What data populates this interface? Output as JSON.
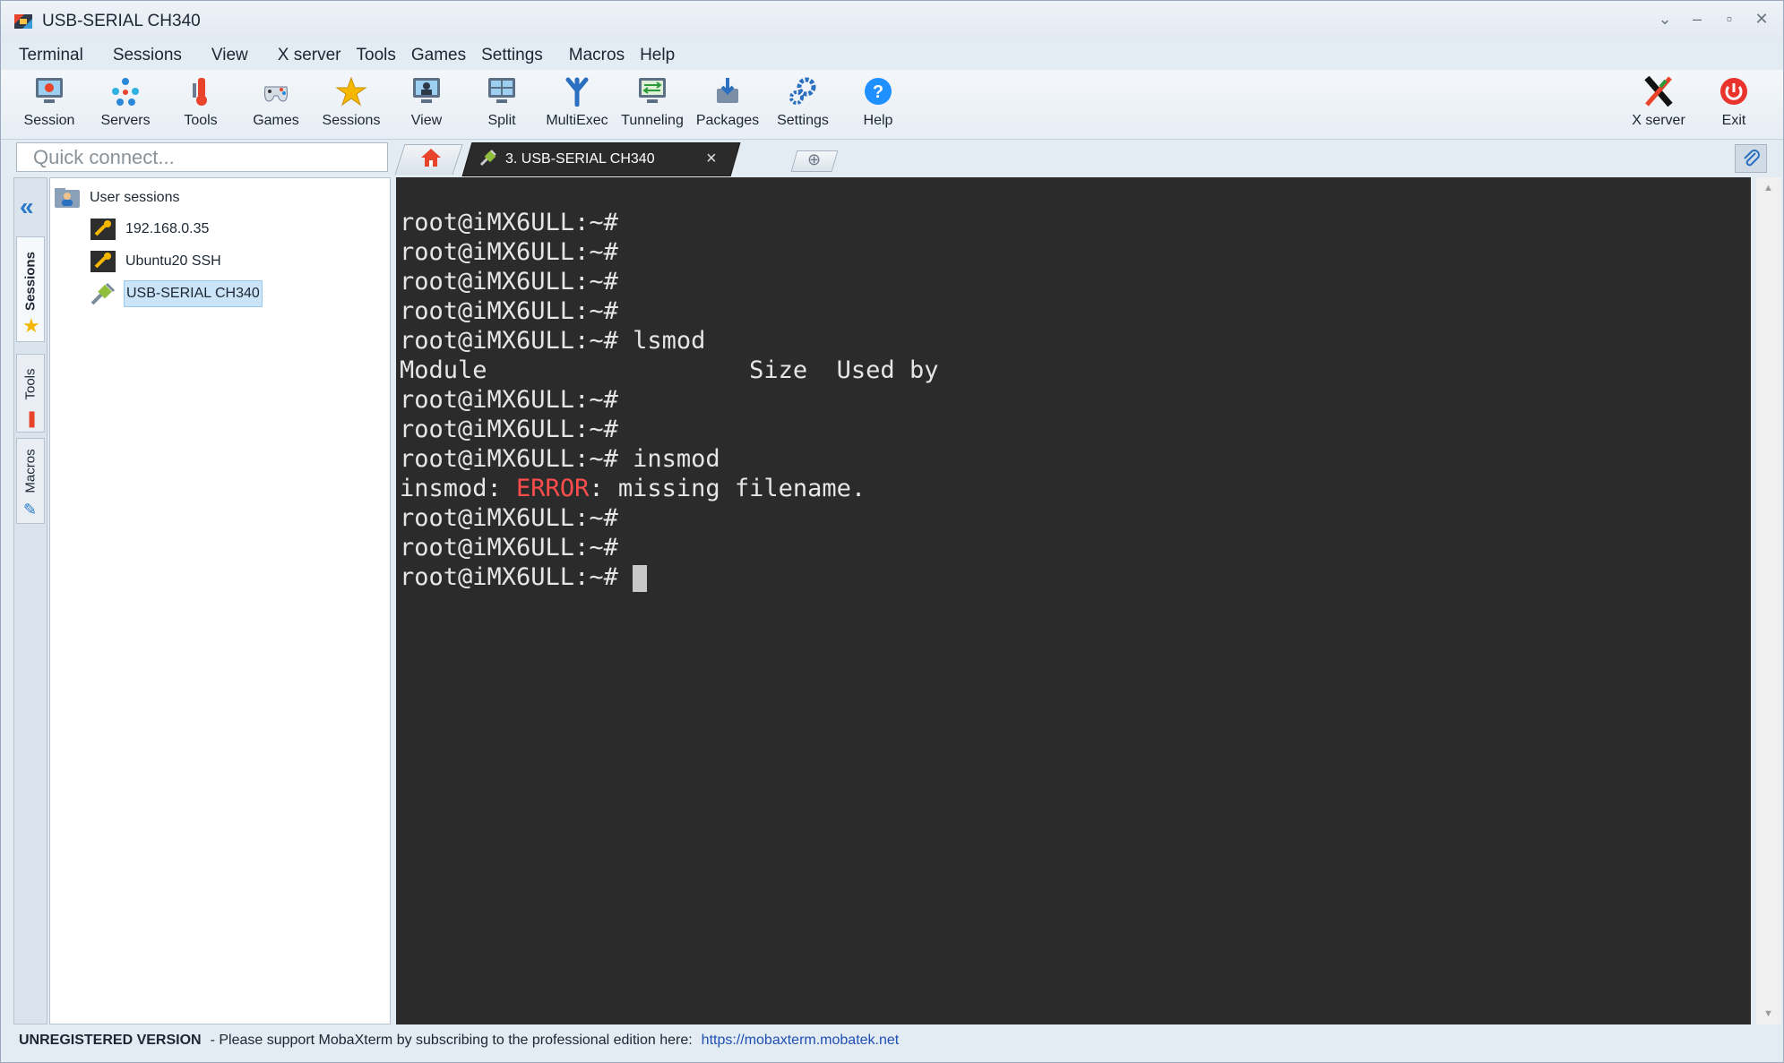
{
  "window": {
    "title": "USB-SERIAL CH340"
  },
  "menu": [
    "Terminal",
    "Sessions",
    "View",
    "X server",
    "Tools",
    "Games",
    "Settings",
    "Macros",
    "Help"
  ],
  "toolbar": {
    "session": "Session",
    "servers": "Servers",
    "tools": "Tools",
    "games": "Games",
    "sessions": "Sessions",
    "view": "View",
    "split": "Split",
    "multiexec": "MultiExec",
    "tunneling": "Tunneling",
    "packages": "Packages",
    "settings": "Settings",
    "help": "Help",
    "xserver": "X server",
    "exit": "Exit"
  },
  "quick_connect": {
    "placeholder": "Quick connect..."
  },
  "tabs": {
    "active_label": "3. USB-SERIAL CH340"
  },
  "sidebar": {
    "tabs": {
      "sessions": "Sessions",
      "tools": "Tools",
      "macros": "Macros"
    },
    "root": "User sessions",
    "items": [
      {
        "label": "192.168.0.35",
        "icon": "ssh-icon"
      },
      {
        "label": "Ubuntu20 SSH",
        "icon": "ssh-icon"
      },
      {
        "label": "USB-SERIAL CH340",
        "icon": "serial-icon",
        "selected": true
      }
    ]
  },
  "terminal": {
    "lines": [
      "root@iMX6ULL:~#",
      "root@iMX6ULL:~#",
      "root@iMX6ULL:~#",
      "root@iMX6ULL:~#",
      "root@iMX6ULL:~# lsmod",
      "Module                  Size  Used by",
      "root@iMX6ULL:~#",
      "root@iMX6ULL:~#",
      "root@iMX6ULL:~# insmod"
    ],
    "error_line": {
      "prefix": "insmod: ",
      "error": "ERROR",
      "suffix": ": missing filename."
    },
    "lines_after": [
      "root@iMX6ULL:~#",
      "root@iMX6ULL:~#"
    ],
    "prompt": "root@iMX6ULL:~# "
  },
  "status": {
    "unregistered": "UNREGISTERED VERSION",
    "message": "-  Please support MobaXterm by subscribing to the professional edition here:",
    "link": "https://mobaxterm.mobatek.net"
  },
  "colors": {
    "terminal_bg": "#2b2b2b",
    "error": "#ff4d4d",
    "accent": "#2a78c9"
  }
}
